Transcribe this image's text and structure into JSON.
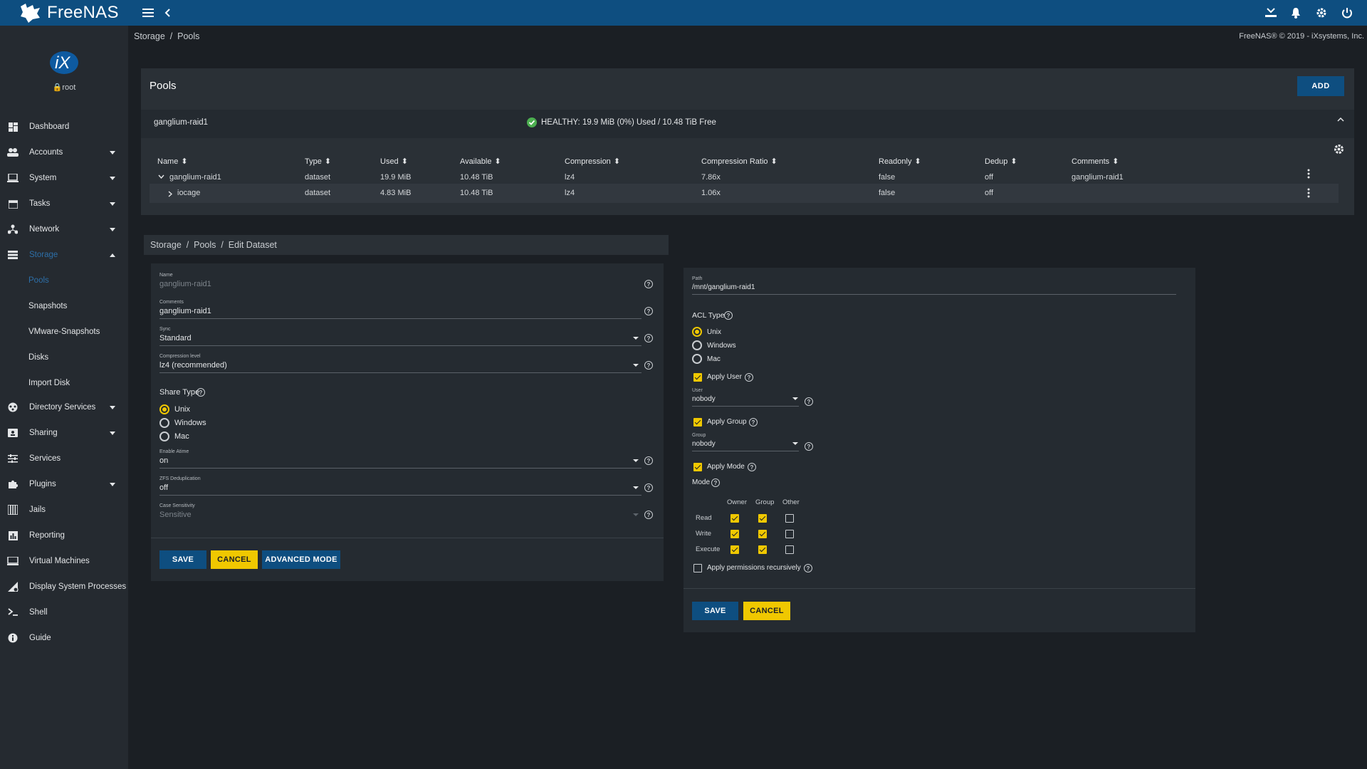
{
  "app": {
    "logo_text": "FreeNAS"
  },
  "topbar": {
    "icons": [
      "menu-icon",
      "chevron-left-icon",
      "upload-icon",
      "bell-icon",
      "gear-icon",
      "power-icon"
    ]
  },
  "breadcrumb_top": "Storage  /  Pools",
  "copyright": "FreeNAS® © 2019 - iXsystems, Inc.",
  "user": {
    "name": "root",
    "avatar_text": "iX"
  },
  "sidebar": {
    "items": [
      {
        "label": "Dashboard",
        "icon": "dashboard-icon"
      },
      {
        "label": "Accounts",
        "icon": "people-icon"
      },
      {
        "label": "System",
        "icon": "laptop-icon"
      },
      {
        "label": "Tasks",
        "icon": "calendar-icon"
      },
      {
        "label": "Network",
        "icon": "network-icon"
      },
      {
        "label": "Storage",
        "icon": "storage-icon"
      },
      {
        "label": "Directory Services",
        "icon": "directory-icon"
      },
      {
        "label": "Sharing",
        "icon": "sharing-icon"
      },
      {
        "label": "Services",
        "icon": "tune-icon"
      },
      {
        "label": "Plugins",
        "icon": "puzzle-icon"
      },
      {
        "label": "Jails",
        "icon": "jail-icon"
      },
      {
        "label": "Reporting",
        "icon": "chart-icon"
      },
      {
        "label": "Virtual Machines",
        "icon": "computer-icon"
      },
      {
        "label": "Display System Processes",
        "icon": "processes-icon"
      },
      {
        "label": "Shell",
        "icon": "terminal-icon"
      },
      {
        "label": "Guide",
        "icon": "info-icon"
      }
    ],
    "storage_sub": [
      "Pools",
      "Snapshots",
      "VMware-Snapshots",
      "Disks",
      "Import Disk"
    ]
  },
  "pools": {
    "title": "Pools",
    "add_label": "ADD",
    "pool_name": "ganglium-raid1",
    "status": "HEALTHY: 19.9 MiB (0%) Used / 10.48 TiB Free",
    "columns": [
      "Name",
      "Type",
      "Used",
      "Available",
      "Compression",
      "Compression Ratio",
      "Readonly",
      "Dedup",
      "Comments"
    ],
    "rows": [
      [
        "ganglium-raid1",
        "dataset",
        "19.9 MiB",
        "10.48 TiB",
        "lz4",
        "7.86x",
        "false",
        "off",
        "ganglium-raid1"
      ],
      [
        "iocage",
        "dataset",
        "4.83 MiB",
        "10.48 TiB",
        "lz4",
        "1.06x",
        "false",
        "off",
        ""
      ]
    ]
  },
  "edit": {
    "breadcrumb": "Storage  /  Pools  /  Edit Dataset",
    "name_label": "Name",
    "name_value": "ganglium-raid1",
    "comments_label": "Comments",
    "comments_value": "ganglium-raid1",
    "sync_label": "Sync",
    "sync_value": "Standard",
    "compression_label": "Compression level",
    "compression_value": "lz4 (recommended)",
    "share_type_label": "Share Type",
    "share_options": [
      "Unix",
      "Windows",
      "Mac"
    ],
    "atime_label": "Enable Atime",
    "atime_value": "on",
    "dedup_label": "ZFS Deduplication",
    "dedup_value": "off",
    "case_label": "Case Sensitivity",
    "case_value": "Sensitive",
    "save": "SAVE",
    "cancel": "CANCEL",
    "advanced": "ADVANCED MODE"
  },
  "acl": {
    "path_label": "Path",
    "path_value": "/mnt/ganglium-raid1",
    "acl_type_label": "ACL Type",
    "acl_options": [
      "Unix",
      "Windows",
      "Mac"
    ],
    "apply_user": "Apply User",
    "user_label": "User",
    "user_value": "nobody",
    "apply_group": "Apply Group",
    "group_label": "Group",
    "group_value": "nobody",
    "apply_mode": "Apply Mode",
    "mode_label": "Mode",
    "mode_cols": [
      "Owner",
      "Group",
      "Other"
    ],
    "mode_rows": [
      "Read",
      "Write",
      "Execute"
    ],
    "recursive": "Apply permissions recursively",
    "save": "SAVE",
    "cancel": "CANCEL"
  },
  "colors": {
    "topbar": "#0e4e80",
    "accent_yellow": "#f0c800",
    "healthy_green": "#4caf50",
    "active_nav": "#2d6fa8"
  }
}
